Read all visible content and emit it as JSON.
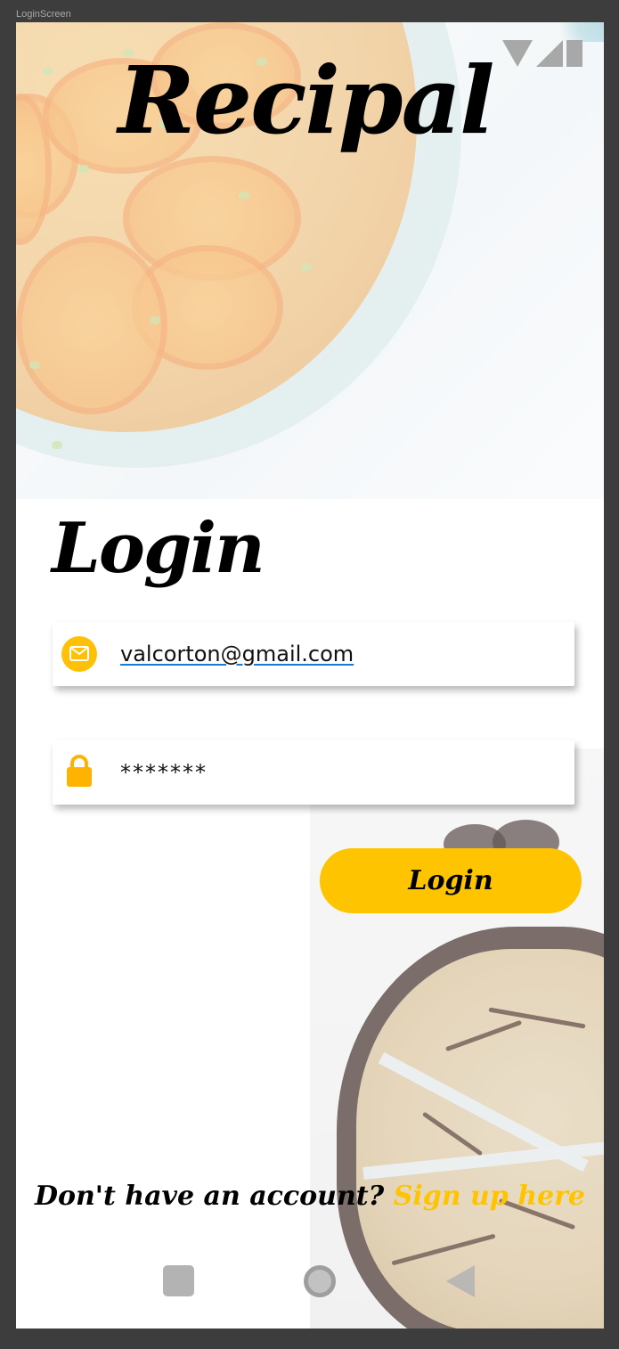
{
  "frame": {
    "label": "LoginScreen"
  },
  "app": {
    "title": "Recipal"
  },
  "screen": {
    "heading": "Login"
  },
  "form": {
    "email": {
      "value": "valcorton@gmail.com",
      "icon": "mail-icon"
    },
    "password": {
      "value": "*******",
      "icon": "lock-icon"
    },
    "submit_label": "Login"
  },
  "signup": {
    "prompt": "Don't have an account?",
    "link": "Sign up here"
  },
  "colors": {
    "accent": "#ffc400",
    "link_underline": "#1a7ad1",
    "frame_bg": "#3d3d3d"
  },
  "status_bar": {
    "icons": [
      "wifi-icon",
      "signal-icon",
      "battery-icon"
    ]
  },
  "nav_bar": {
    "icons": [
      "recents-icon",
      "home-icon",
      "back-icon"
    ]
  }
}
